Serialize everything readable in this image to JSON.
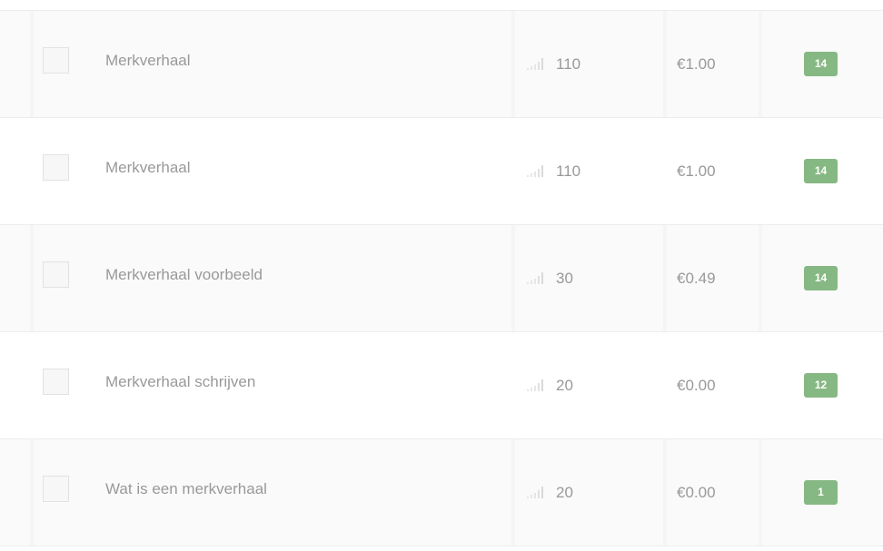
{
  "colors": {
    "badge": "#86b883",
    "text": "#999999",
    "row_shaded": "#fafafa",
    "row_plain": "#ffffff"
  },
  "rows": [
    {
      "keyword": "Merkverhaal",
      "volume": "110",
      "cpc": "€1.00",
      "score": "14",
      "shaded": true
    },
    {
      "keyword": "Merkverhaal",
      "volume": "110",
      "cpc": "€1.00",
      "score": "14",
      "shaded": false
    },
    {
      "keyword": "Merkverhaal voorbeeld",
      "volume": "30",
      "cpc": "€0.49",
      "score": "14",
      "shaded": true
    },
    {
      "keyword": "Merkverhaal schrijven",
      "volume": "20",
      "cpc": "€0.00",
      "score": "12",
      "shaded": false
    },
    {
      "keyword": "Wat is een merkverhaal",
      "volume": "20",
      "cpc": "€0.00",
      "score": "1",
      "shaded": true
    }
  ]
}
